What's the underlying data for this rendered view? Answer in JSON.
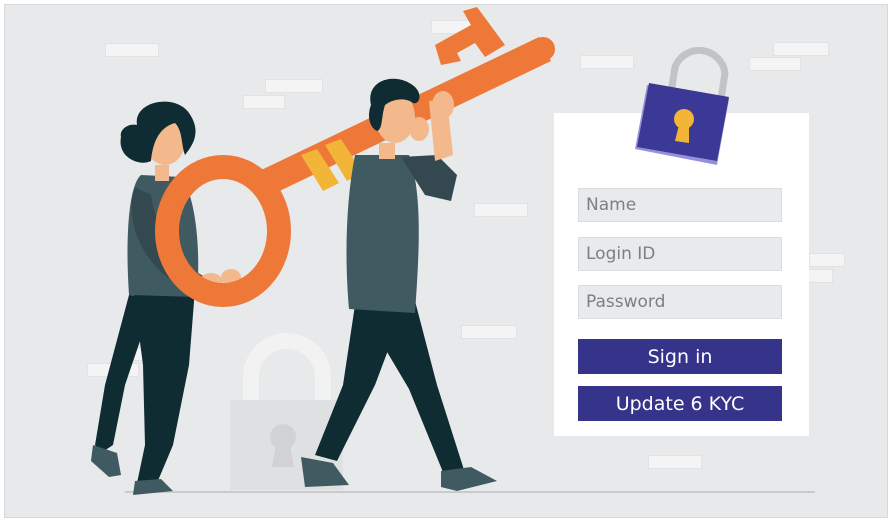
{
  "login_form": {
    "name_placeholder": "Name",
    "login_id_placeholder": "Login ID",
    "password_placeholder": "Password",
    "sign_in_label": "Sign in",
    "update_kyc_label": "Update 6 KYC"
  },
  "colors": {
    "background": "#e8e9ea",
    "card": "#ffffff",
    "field": "#e9eaeb",
    "button": "#36338b",
    "key": "#ee7838",
    "lock_body": "#3b3896",
    "figure_teal": "#3f5a60",
    "figure_dark": "#0f2c33"
  },
  "icons": [
    "padlock-icon",
    "key-illustration",
    "background-padlock-icon"
  ]
}
